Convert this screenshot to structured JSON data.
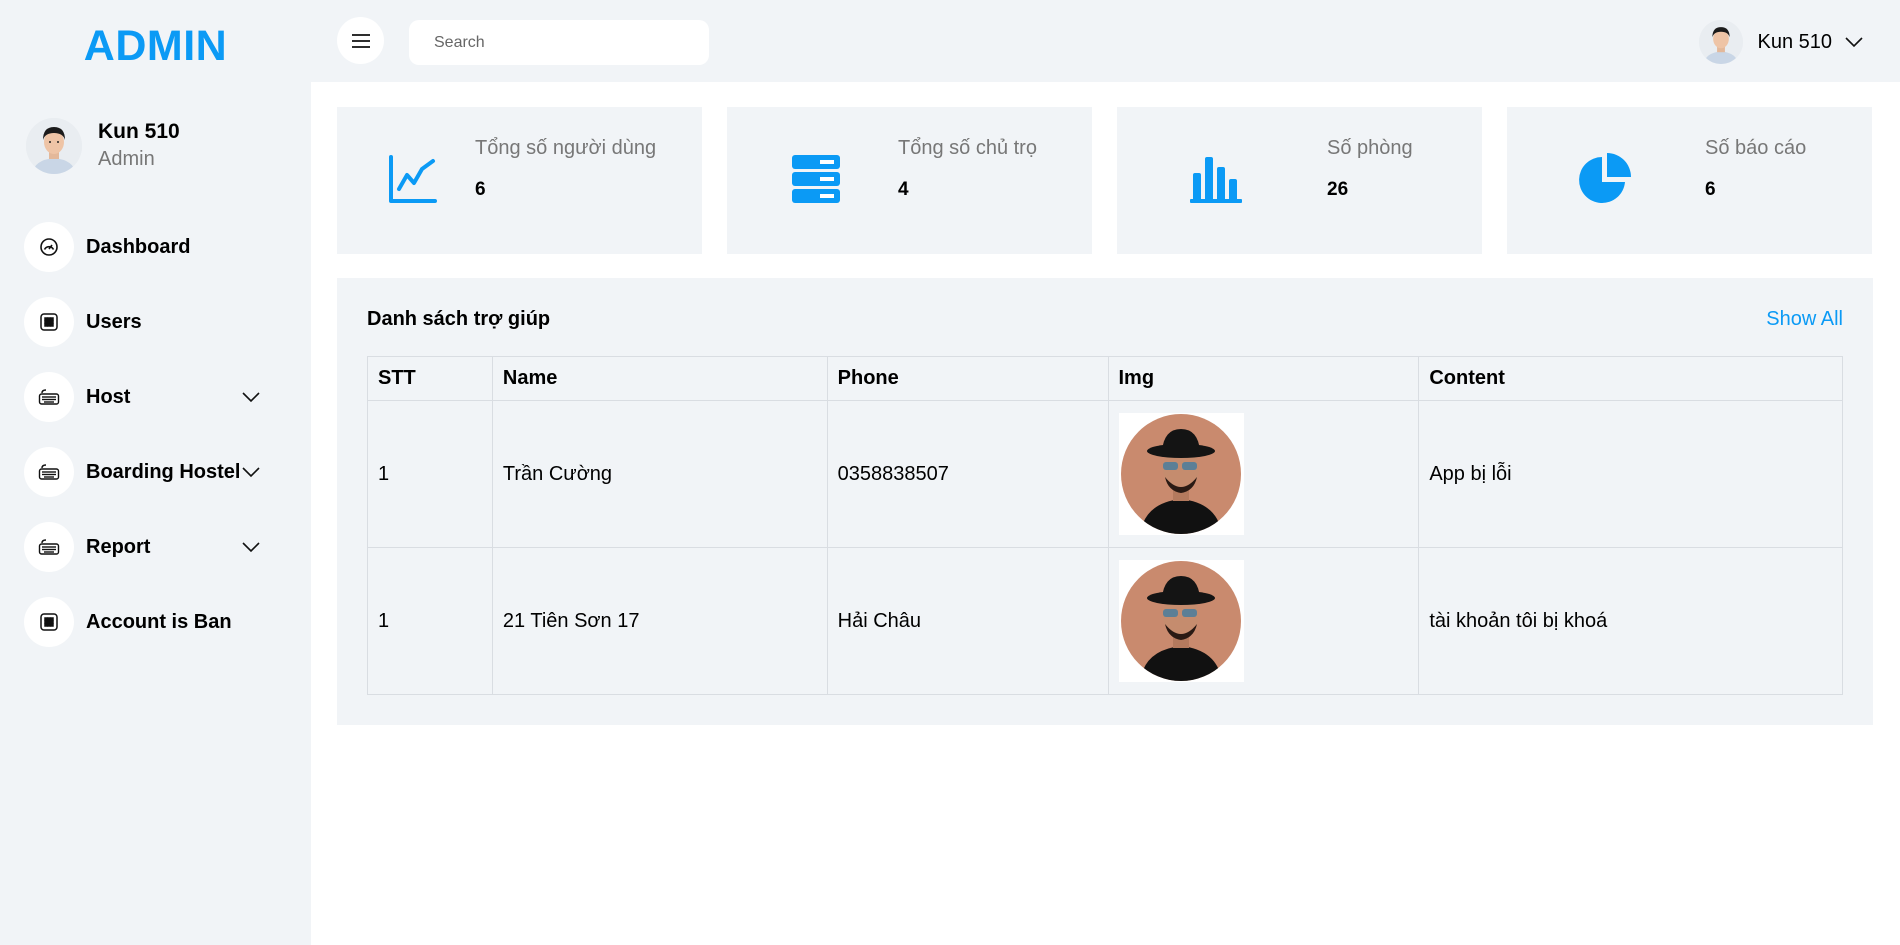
{
  "brand": "ADMIN",
  "profile": {
    "name": "Kun 510",
    "role": "Admin"
  },
  "nav": {
    "items": [
      {
        "label": "Dashboard",
        "icon": "speedometer-icon"
      },
      {
        "label": "Users",
        "icon": "grid-icon"
      },
      {
        "label": "Host",
        "icon": "keyboard-icon"
      },
      {
        "label": "Boarding Hostel",
        "icon": "keyboard-icon"
      },
      {
        "label": "Report",
        "icon": "keyboard-icon"
      },
      {
        "label": "Account is Ban",
        "icon": "grid-icon"
      }
    ]
  },
  "search": {
    "placeholder": "Search",
    "value": ""
  },
  "user_menu": {
    "name": "Kun 510"
  },
  "stats": [
    {
      "title": "Tổng số người dùng",
      "value": "6",
      "icon": "line-chart-icon"
    },
    {
      "title": "Tổng số chủ trọ",
      "value": "4",
      "icon": "server-icon"
    },
    {
      "title": "Số phòng",
      "value": "26",
      "icon": "bar-chart-icon"
    },
    {
      "title": "Số báo cáo",
      "value": "6",
      "icon": "pie-chart-icon"
    }
  ],
  "help": {
    "title": "Danh sách trợ giúp",
    "show_all": "Show All",
    "columns": [
      "STT",
      "Name",
      "Phone",
      "Img",
      "Content"
    ],
    "rows": [
      {
        "stt": "1",
        "name": "Trần Cường",
        "phone": "0358838507",
        "content": "App bị lỗi"
      },
      {
        "stt": "1",
        "name": "21 Tiên Sơn 17",
        "phone": "Hải Châu",
        "content": "tài khoản tôi bị khoá"
      }
    ]
  },
  "colors": {
    "accent": "#0b9af5",
    "background": "#f1f4f7",
    "surface": "#ffffff"
  }
}
